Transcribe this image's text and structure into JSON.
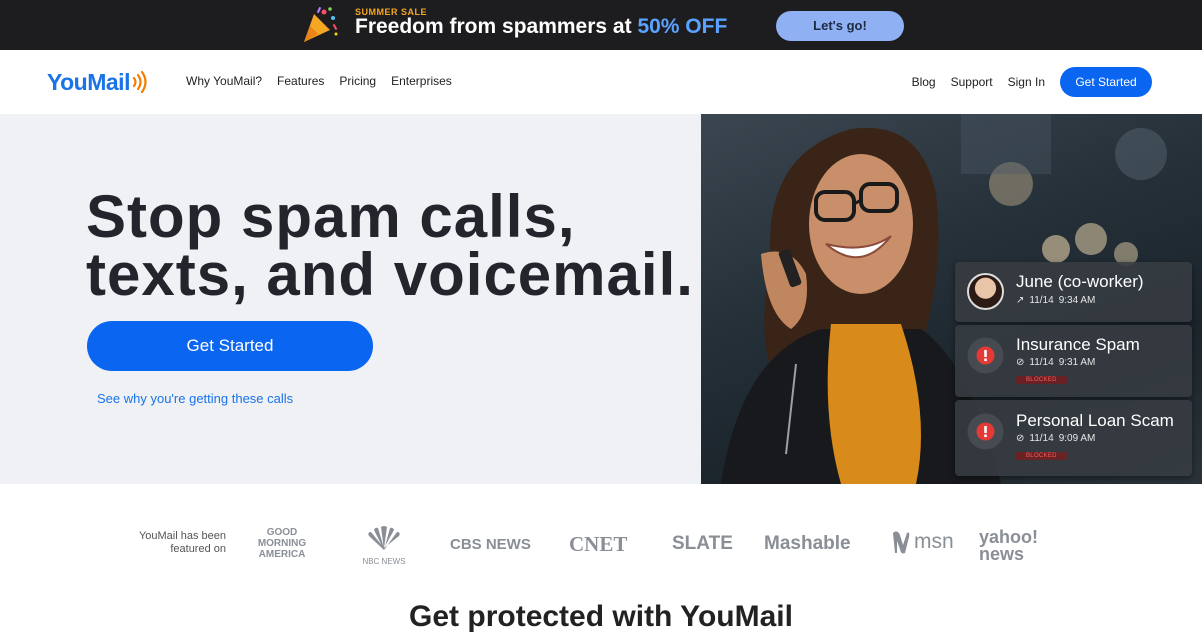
{
  "promo": {
    "tag": "SUMMER SALE",
    "title_main": "Freedom from spammers at ",
    "title_highlight": "50% OFF",
    "button_label": "Let's go!"
  },
  "nav": {
    "logo": "YouMail",
    "links": [
      "Why YouMail?",
      "Features",
      "Pricing",
      "Enterprises"
    ],
    "right_links": [
      "Blog",
      "Support",
      "Sign In"
    ],
    "cta_label": "Get Started"
  },
  "hero": {
    "title_line1": "Stop spam calls,",
    "title_line2": "texts, and voicemail.",
    "cta_label": "Get Started",
    "secondary_link": "See why you're getting these calls"
  },
  "call_cards": [
    {
      "name": "June (co-worker)",
      "date": "11/14",
      "time": "9:34 AM",
      "icon": "outgoing-arrow-icon",
      "badge": ""
    },
    {
      "name": "Insurance Spam",
      "date": "11/14",
      "time": "9:31 AM",
      "icon": "blocked-icon",
      "badge": "BLOCKED"
    },
    {
      "name": "Personal Loan Scam",
      "date": "11/14",
      "time": "9:09 AM",
      "icon": "blocked-icon",
      "badge": "BLOCKED"
    }
  ],
  "press": {
    "label_line1": "YouMail has been",
    "label_line2": "featured on",
    "logos": [
      "GOOD MORNING AMERICA",
      "NBC NEWS",
      "CBS NEWS",
      "CNET",
      "SLATE",
      "Mashable",
      "msn",
      "yahoo! news"
    ]
  },
  "section": {
    "title": "Get protected with YouMail"
  },
  "colors": {
    "accent": "#0a66f0",
    "promo_bg": "#1d1d1f",
    "hero_bg": "#f0f1f5",
    "blocked_red": "#e53935"
  }
}
